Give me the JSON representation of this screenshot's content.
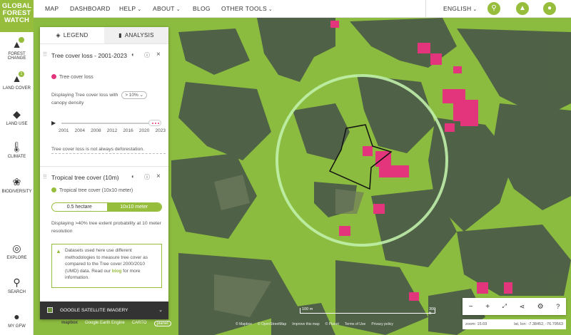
{
  "logo": [
    "GLOBAL",
    "FOREST",
    "WATCH"
  ],
  "sidebar": {
    "items": [
      {
        "label": "Forest change",
        "icon": "tree-icon",
        "badge": ""
      },
      {
        "label": "Land cover",
        "icon": "tree-icon",
        "badge": "1"
      },
      {
        "label": "Land use",
        "icon": "layers-icon",
        "badge": ""
      },
      {
        "label": "Climate",
        "icon": "thermometer-icon",
        "badge": ""
      },
      {
        "label": "Biodiversity",
        "icon": "paw-icon",
        "badge": ""
      },
      {
        "label": "Explore",
        "icon": "compass-icon",
        "badge": ""
      },
      {
        "label": "Search",
        "icon": "search-icon",
        "badge": ""
      },
      {
        "label": "My GFW",
        "icon": "user-icon",
        "badge": ""
      }
    ]
  },
  "nav": {
    "items": [
      {
        "label": "MAP",
        "dropdown": false
      },
      {
        "label": "DASHBOARD",
        "dropdown": false
      },
      {
        "label": "HELP",
        "dropdown": true
      },
      {
        "label": "ABOUT",
        "dropdown": true
      },
      {
        "label": "BLOG",
        "dropdown": false
      },
      {
        "label": "OTHER TOOLS",
        "dropdown": true
      }
    ],
    "language": "ENGLISH",
    "accent": "#97bd3d"
  },
  "panel": {
    "tabs": {
      "legend": "LEGEND",
      "analysis": "ANALYSIS"
    },
    "layer1": {
      "title": "Tree cover loss - 2001-2023",
      "legend_label": "Tree cover loss",
      "legend_color": "#e2357b",
      "desc_prefix": "Displaying Tree cover loss with",
      "threshold": "> 10%",
      "desc_suffix": "canopy density",
      "years": [
        "2001",
        "2004",
        "2008",
        "2012",
        "2016",
        "2020",
        "2023"
      ],
      "note": "Tree cover loss is not always deforestation."
    },
    "layer2": {
      "title": "Tropical tree cover (10m)",
      "legend_label": "Tropical tree cover (10x10 meter)",
      "legend_color": "#97bd3d",
      "toggle": [
        "0.5 hectare",
        "10x10 meter"
      ],
      "toggle_selected": "10x10 meter",
      "desc": "Displaying >40% tree extent probability at 10 meter resolution",
      "notice_text": "Datasets used here use different methodologies to measure tree cover as compared to the Tree cover 2000/2010 (UMD) data. Read our",
      "notice_link": "blog",
      "notice_end": "for more information."
    },
    "basemap": "GOOGLE SATELLITE IMAGERY"
  },
  "map": {
    "zoom": "zoom: 15.69",
    "latlon": "lat, lon: -7.38452, -76.79563",
    "scale_left": "100 m",
    "scale_right": "300 ft",
    "attributions": [
      "mapbox",
      "Google Earth Engine",
      "CARTO",
      "planet"
    ],
    "attrib_right": [
      "© Mapbox",
      "© OpenStreetMap",
      "Improve this map",
      "© Planet",
      "Terms of Use",
      "Privacy policy"
    ]
  }
}
